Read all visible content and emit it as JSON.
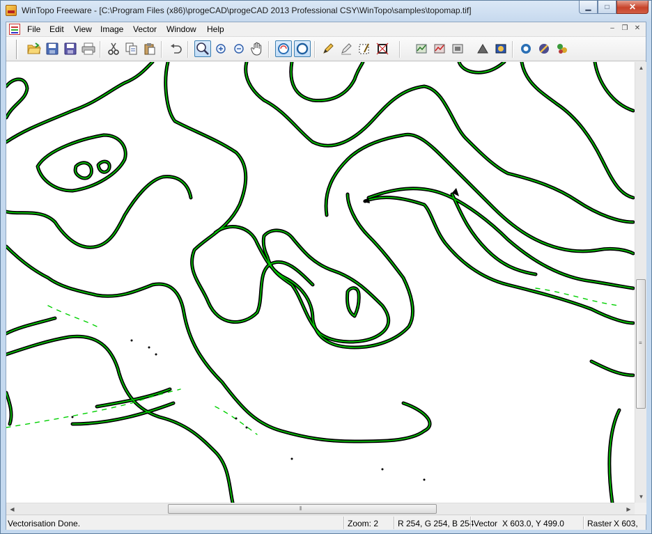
{
  "window": {
    "title": "WinTopo Freeware - [C:\\Program Files (x86)\\progeCAD\\progeCAD 2013 Professional CSY\\WinTopo\\samples\\topomap.tif]",
    "controls": {
      "minimize": "▁",
      "maximize": "□",
      "close": "✕"
    }
  },
  "menubar": {
    "items": [
      "File",
      "Edit",
      "View",
      "Image",
      "Vector",
      "Window",
      "Help"
    ],
    "mdi_controls": {
      "minimize": "–",
      "restore": "❐",
      "close": "✕"
    }
  },
  "toolbar": {
    "buttons": [
      {
        "icon": "open-folder-icon"
      },
      {
        "icon": "save-icon"
      },
      {
        "icon": "save-as-icon"
      },
      {
        "icon": "print-icon"
      },
      {
        "icon": "cut-icon"
      },
      {
        "icon": "copy-icon"
      },
      {
        "icon": "paste-icon"
      },
      {
        "icon": "undo-icon"
      },
      {
        "icon": "zoom-window-icon"
      },
      {
        "icon": "zoom-in-icon"
      },
      {
        "icon": "zoom-out-icon"
      },
      {
        "icon": "pan-hand-icon"
      },
      {
        "icon": "show-raster-icon"
      },
      {
        "icon": "show-vector-icon"
      },
      {
        "icon": "pencil-icon"
      },
      {
        "icon": "eraser-pencil-icon"
      },
      {
        "icon": "select-box-icon"
      },
      {
        "icon": "crop-icon"
      },
      {
        "icon": "filter-icon-1"
      },
      {
        "icon": "filter-icon-2"
      },
      {
        "icon": "filter-icon-3"
      },
      {
        "icon": "vectorise-icon"
      },
      {
        "icon": "polyline-icon"
      },
      {
        "icon": "info-icon"
      },
      {
        "icon": "tools-icon"
      },
      {
        "icon": "wizard-icon"
      }
    ]
  },
  "canvas": {
    "image_name": "topomap.tif",
    "raster_color": "#000000",
    "vector_color": "#00d000"
  },
  "statusbar": {
    "message": "Vectorisation Done.",
    "zoom": "Zoom: 2",
    "rgb": "R 254, G 254, B 254",
    "vector_label": "Vector",
    "vector_coords": "X 603.0, Y 499.0",
    "raster_label": "Raster",
    "raster_coords": "X 603,"
  },
  "colors": {
    "title_bg": "#c6d9ee",
    "close_button": "#c7432a",
    "pressed_button": "#c1dcf6"
  }
}
